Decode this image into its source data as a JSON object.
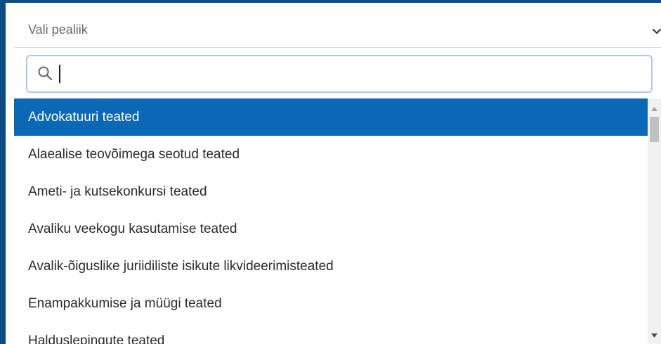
{
  "select": {
    "placeholder": "Vali pealiik",
    "icon": "chevron-down-icon"
  },
  "search": {
    "value": "",
    "icon": "search-icon"
  },
  "list": {
    "items": [
      {
        "label": "Advokatuuri teated",
        "selected": true
      },
      {
        "label": "Alaealise teovõimega seotud teated",
        "selected": false
      },
      {
        "label": "Ameti- ja kutsekonkursi teated",
        "selected": false
      },
      {
        "label": "Avaliku veekogu kasutamise teated",
        "selected": false
      },
      {
        "label": "Avalik-õiguslike juriidiliste isikute likvideerimisteated",
        "selected": false
      },
      {
        "label": "Enampakkumise ja müügi teated",
        "selected": false
      },
      {
        "label": "Halduslepingute teated",
        "selected": false
      }
    ]
  },
  "colors": {
    "accent": "#0a68b6",
    "frame": "#0b4d84",
    "focus_ring": "#a9cbe9"
  }
}
